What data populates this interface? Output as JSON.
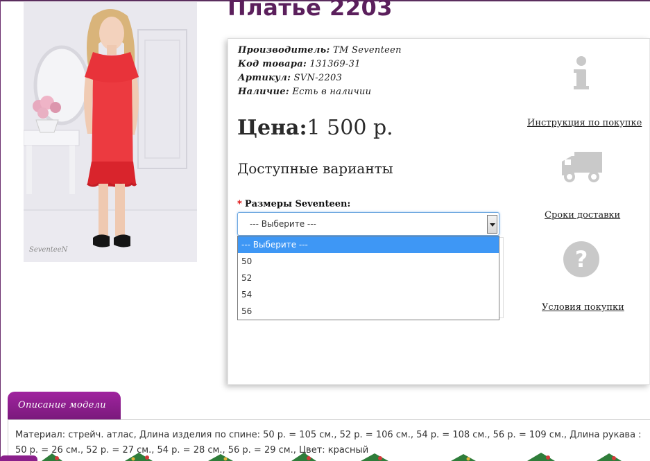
{
  "product": {
    "title": "Платье 2203",
    "photo_alt": "red satin dress",
    "photo_signature": "SeventeeN"
  },
  "meta": [
    {
      "label": "Производитель:",
      "value": "TM Seventeen"
    },
    {
      "label": "Код товара:",
      "value": "131369-31"
    },
    {
      "label": "Артикул:",
      "value": "SVN-2203"
    },
    {
      "label": "Наличие:",
      "value": "Есть в наличии"
    }
  ],
  "price": {
    "label": "Цена:",
    "value": "1 500 р."
  },
  "variants": {
    "heading": "Доступные варианты",
    "size_label": "Размеры Seventeen:",
    "required_mark": "*",
    "selected": "--- Выберите ---",
    "options": [
      "--- Выберите ---",
      "50",
      "52",
      "54",
      "56"
    ]
  },
  "side_links": {
    "instructions": "Инструкция по покупке",
    "delivery": "Сроки доставки",
    "terms": "Условия покупки"
  },
  "icons": {
    "info": "info-icon",
    "truck": "truck-icon",
    "question": "question-icon"
  },
  "tabs": {
    "description": "Описание модели"
  },
  "description": "Материал: стрейч. атлас, Длина изделия по спине: 50 р. = 105 см., 52 р. = 106 см., 54 р. = 108 см., 56 р. = 109 см., Длина рукава : 50 р. = 26 см., 52 р. = 27 см., 54 р. = 28 см., 56 р. = 29 см., Цвет: красный",
  "colors": {
    "title": "#5b1f5c",
    "tab": "#8a1f8b",
    "dress": "#e8333a",
    "option_highlight": "#3e97f5"
  }
}
